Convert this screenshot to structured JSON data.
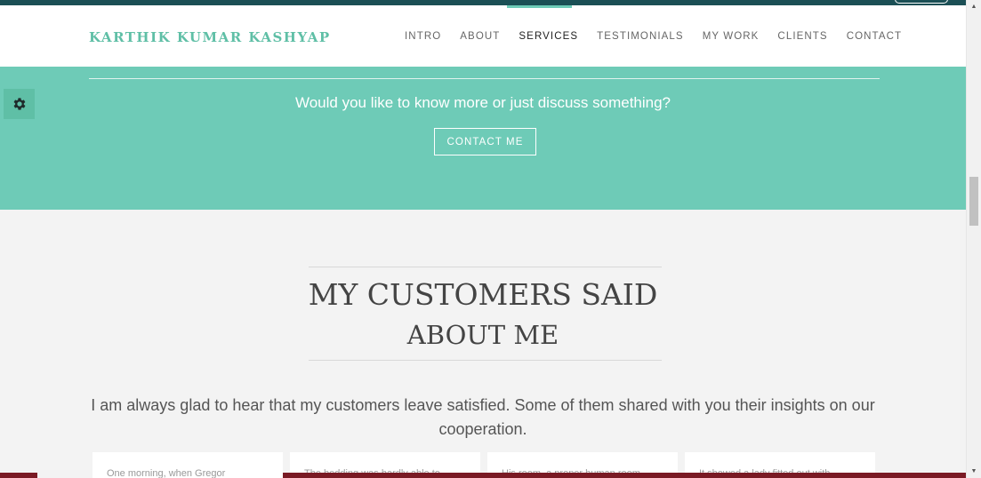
{
  "header": {
    "brand": "KARTHIK KUMAR KASHYAP",
    "nav": [
      "INTRO",
      "ABOUT",
      "SERVICES",
      "TESTIMONIALS",
      "MY WORK",
      "CLIENTS",
      "CONTACT"
    ],
    "active_nav": "SERVICES"
  },
  "cta": {
    "question": "Would you like to know more or just discuss something?",
    "button_label": "CONTACT ME"
  },
  "testimonials": {
    "title_line1": "MY CUSTOMERS SAID",
    "title_line2": "ABOUT ME",
    "lead": "I am always glad to hear that my customers leave satisfied. Some of them shared with you their insights on our cooperation.",
    "cards": [
      "One morning, when Gregor",
      "The bedding was hardly able to",
      "His room, a proper human room",
      "It showed a lady fitted out with"
    ]
  },
  "icons": {
    "settings": "gear-icon",
    "scroll_up": "arrow-up-icon",
    "scroll_down": "arrow-down-icon"
  },
  "colors": {
    "accent": "#6ecbb7",
    "brand": "#5fbfa6",
    "dark_bar": "#1b4f55",
    "footer_strip": "#7a1a24"
  }
}
